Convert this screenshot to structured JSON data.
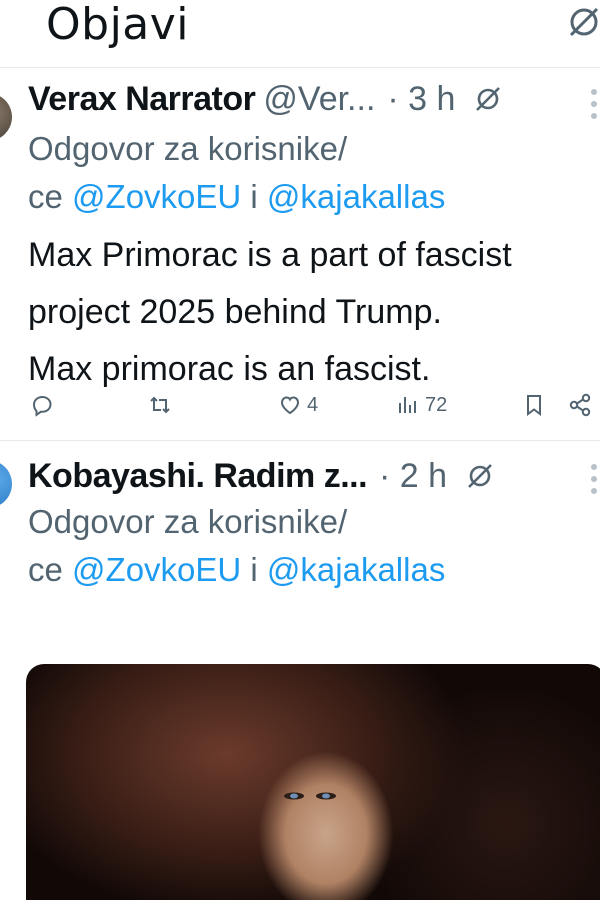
{
  "header": {
    "title": "Objavi",
    "icon": "grok-icon"
  },
  "tweets": [
    {
      "author": "Verax Narrator",
      "handle": "@Ver...",
      "time": "· 3 h",
      "reply_prefix": "Odgovor za korisnike/",
      "reply_line2_prefix": "ce ",
      "mention_1": "@ZovkoEU",
      "conj": " i ",
      "mention_2": "@kajakallas",
      "body_lines": [
        "Max Primorac is a part of fascist",
        "project 2025 behind Trump.",
        "Max primorac is an fascist."
      ],
      "actions": {
        "reply_count": "",
        "retweet_count": "",
        "like_count": "4",
        "views_count": "72"
      }
    },
    {
      "author": "Kobayashi. Radim z...",
      "time": "· 2 h",
      "reply_prefix": "Odgovor za korisnike/",
      "reply_line2_prefix": "ce ",
      "mention_1": "@ZovkoEU",
      "conj": " i ",
      "mention_2": "@kajakallas"
    }
  ],
  "colors": {
    "text": "#0f1419",
    "secondary": "#536471",
    "mention": "#1d9bf0",
    "divider": "#e6e9ec"
  }
}
